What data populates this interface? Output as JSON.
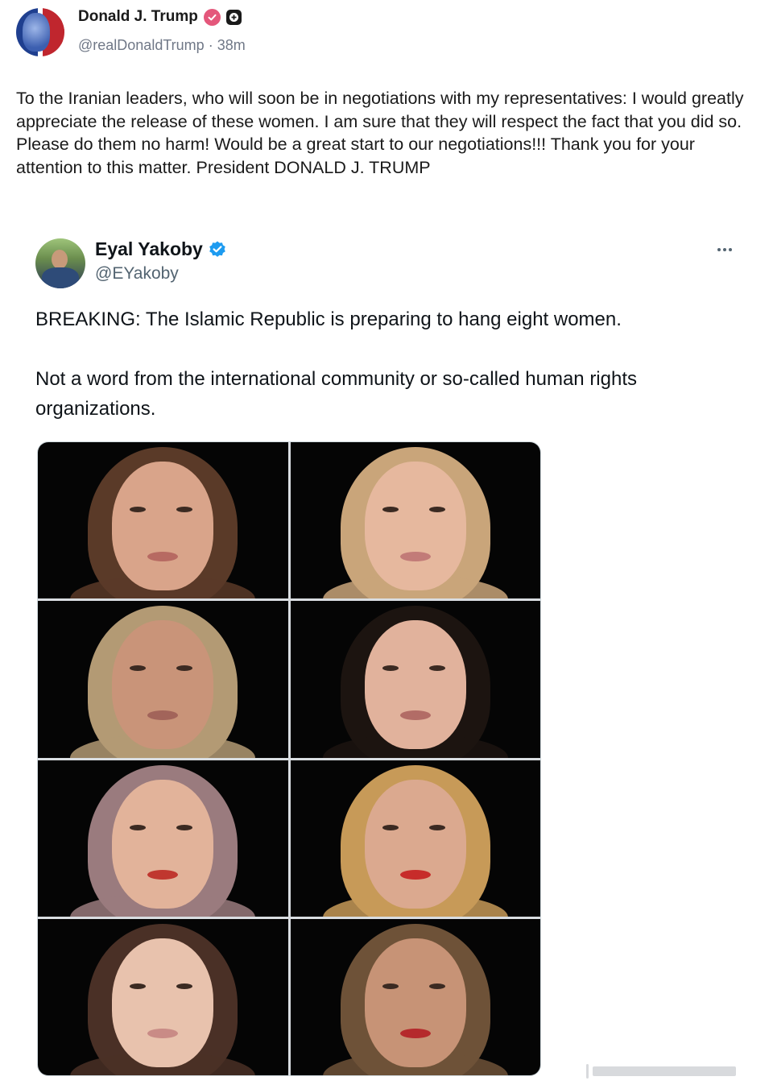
{
  "truth_post": {
    "author_name": "Donald J. Trump",
    "handle": "@realDonaldTrump",
    "separator": "·",
    "time_ago": "38m",
    "text": "To the Iranian leaders, who will soon be in negotiations with my representatives: I would greatly appreciate the release of these women. I am sure that they will respect the fact that you did so. Please do them no harm! Would be a great start to our negotiations!!! Thank you for your attention to this matter. President DONALD J. TRUMP"
  },
  "quoted_post": {
    "author_name": "Eyal Yakoby",
    "handle": "@EYakoby",
    "paragraphs": [
      "BREAKING: The Islamic Republic is preparing to hang eight women.",
      "Not a word from the international community or so-called human rights organizations."
    ],
    "photos": [
      {
        "hair": "#5a3a28",
        "skin": "#d9a48a",
        "lips": "#b76a62"
      },
      {
        "hair": "#c9a57a",
        "skin": "#e6b89e",
        "lips": "#c27b78"
      },
      {
        "hair": "#b39a74",
        "skin": "#c99479",
        "lips": "#a2645a"
      },
      {
        "hair": "#1c1410",
        "skin": "#e1b29c",
        "lips": "#b26c66"
      },
      {
        "hair": "#9a7b7e",
        "skin": "#e2b39a",
        "lips": "#c0372f"
      },
      {
        "hair": "#c79a58",
        "skin": "#dba98f",
        "lips": "#c72c2a"
      },
      {
        "hair": "#4a3026",
        "skin": "#e8c2ad",
        "lips": "#c98b86"
      },
      {
        "hair": "#6e5238",
        "skin": "#c79376",
        "lips": "#b52a2c"
      }
    ]
  },
  "colors": {
    "truth_badge": "#e4577b",
    "verified_blue": "#1d9bf0"
  }
}
